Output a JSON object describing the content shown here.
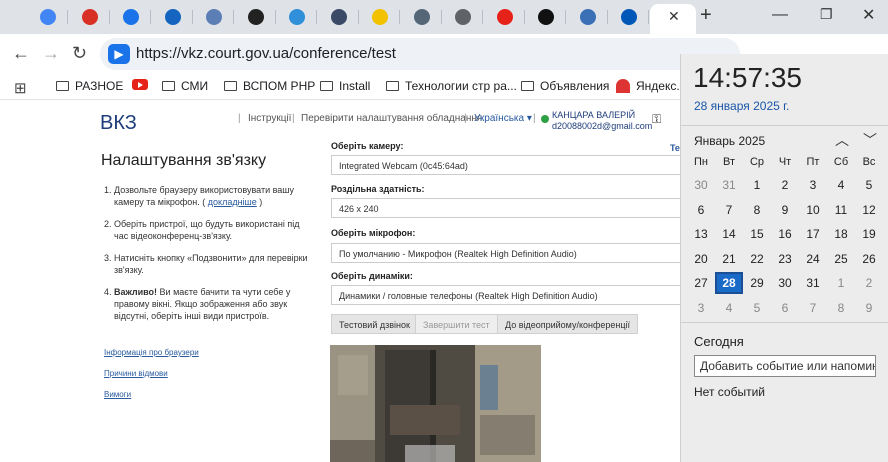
{
  "browser": {
    "tab_favicon_colors": [
      "#4285f4",
      "#d93025",
      "#1a73e8",
      "#1565c0",
      "#5b7fb5",
      "#222222",
      "#2f8fd8",
      "#3a4a66",
      "#f2c200",
      "#556677",
      "#5f6368",
      "#e62117",
      "#111111",
      "#3b6fb6",
      "#0057b7"
    ],
    "url": "https://vkz.court.gov.ua/conference/test",
    "bookmarks": [
      {
        "label": "РАЗНОЕ",
        "icon": "folder-icon"
      },
      {
        "label": "",
        "icon": "youtube-icon"
      },
      {
        "label": "СМИ",
        "icon": "folder-icon"
      },
      {
        "label": "ВСПОМ РНР",
        "icon": "folder-icon"
      },
      {
        "label": "Install",
        "icon": "folder-icon"
      },
      {
        "label": "Технологии стр ра...",
        "icon": "folder-icon"
      },
      {
        "label": "Объявления",
        "icon": "folder-icon"
      },
      {
        "label": "Яндекс.П",
        "icon": "umbrella-icon"
      }
    ]
  },
  "site": {
    "brand": "ВКЗ",
    "nav": {
      "instructions": "Інструкції",
      "check_equipment": "Перевірити налаштування обладнання",
      "language": "Українська ▾"
    },
    "user": {
      "name": "КАНЦАРА ВАЛЕРІЙ",
      "email": "d20088002d@gmail.com"
    },
    "settings_title": "Налаштування зв'язку",
    "steps": [
      {
        "num": "1.",
        "text": "Дозвольте браузеру використовувати вашу камеру та мікрофон. ( ",
        "link": "докладніше",
        "tail": " )"
      },
      {
        "num": "2.",
        "text": "Оберіть пристрої, що будуть використані під час відеоконференц-зв'язку."
      },
      {
        "num": "3.",
        "text": "Натисніть кнопку «Подзвонити» для перевірки зв'язку."
      },
      {
        "num": "4.",
        "bold": "Важливо!",
        "text": " Ви маєте бачити та чути себе у правому вікні. Якщо зображення або звук відсутні, оберіть інші види пристроїв."
      }
    ],
    "side_links": {
      "browser_info": "Інформація про браузери",
      "reasons": "Причини відмови",
      "requirements": "Вимоги"
    },
    "te_label": "Te",
    "fields": {
      "camera_label": "Оберіть камеру:",
      "camera_value": "Integrated Webcam (0c45:64ad)",
      "resolution_label": "Роздільна здатність:",
      "resolution_value": "426 x 240",
      "mic_label": "Оберіть мікрофон:",
      "mic_value": "По умолчанию - Микрофон (Realtek High Definition Audio)",
      "speaker_label": "Оберіть динаміки:",
      "speaker_value": "Динамики / головные телефоны (Realtek High Definition Audio)"
    },
    "buttons": {
      "test_call": "Тестовий дзвінок",
      "end_test": "Завершити тест",
      "to_conference": "До відеоприйому/конференції"
    }
  },
  "calendar": {
    "time": "14:57:35",
    "date": "28 января 2025 г.",
    "month": "Январь 2025",
    "weekdays": [
      "Пн",
      "Вт",
      "Ср",
      "Чт",
      "Пт",
      "Сб",
      "Вс"
    ],
    "weeks": [
      [
        "30",
        "31",
        "1",
        "2",
        "3",
        "4",
        "5"
      ],
      [
        "6",
        "7",
        "8",
        "9",
        "10",
        "11",
        "12"
      ],
      [
        "13",
        "14",
        "15",
        "16",
        "17",
        "18",
        "19"
      ],
      [
        "20",
        "21",
        "22",
        "23",
        "24",
        "25",
        "26"
      ],
      [
        "27",
        "28",
        "29",
        "30",
        "31",
        "1",
        "2"
      ],
      [
        "3",
        "4",
        "5",
        "6",
        "7",
        "8",
        "9"
      ]
    ],
    "today_label": "Сегодня",
    "add_event_placeholder": "Добавить событие или напомина",
    "no_events": "Нет событий"
  }
}
